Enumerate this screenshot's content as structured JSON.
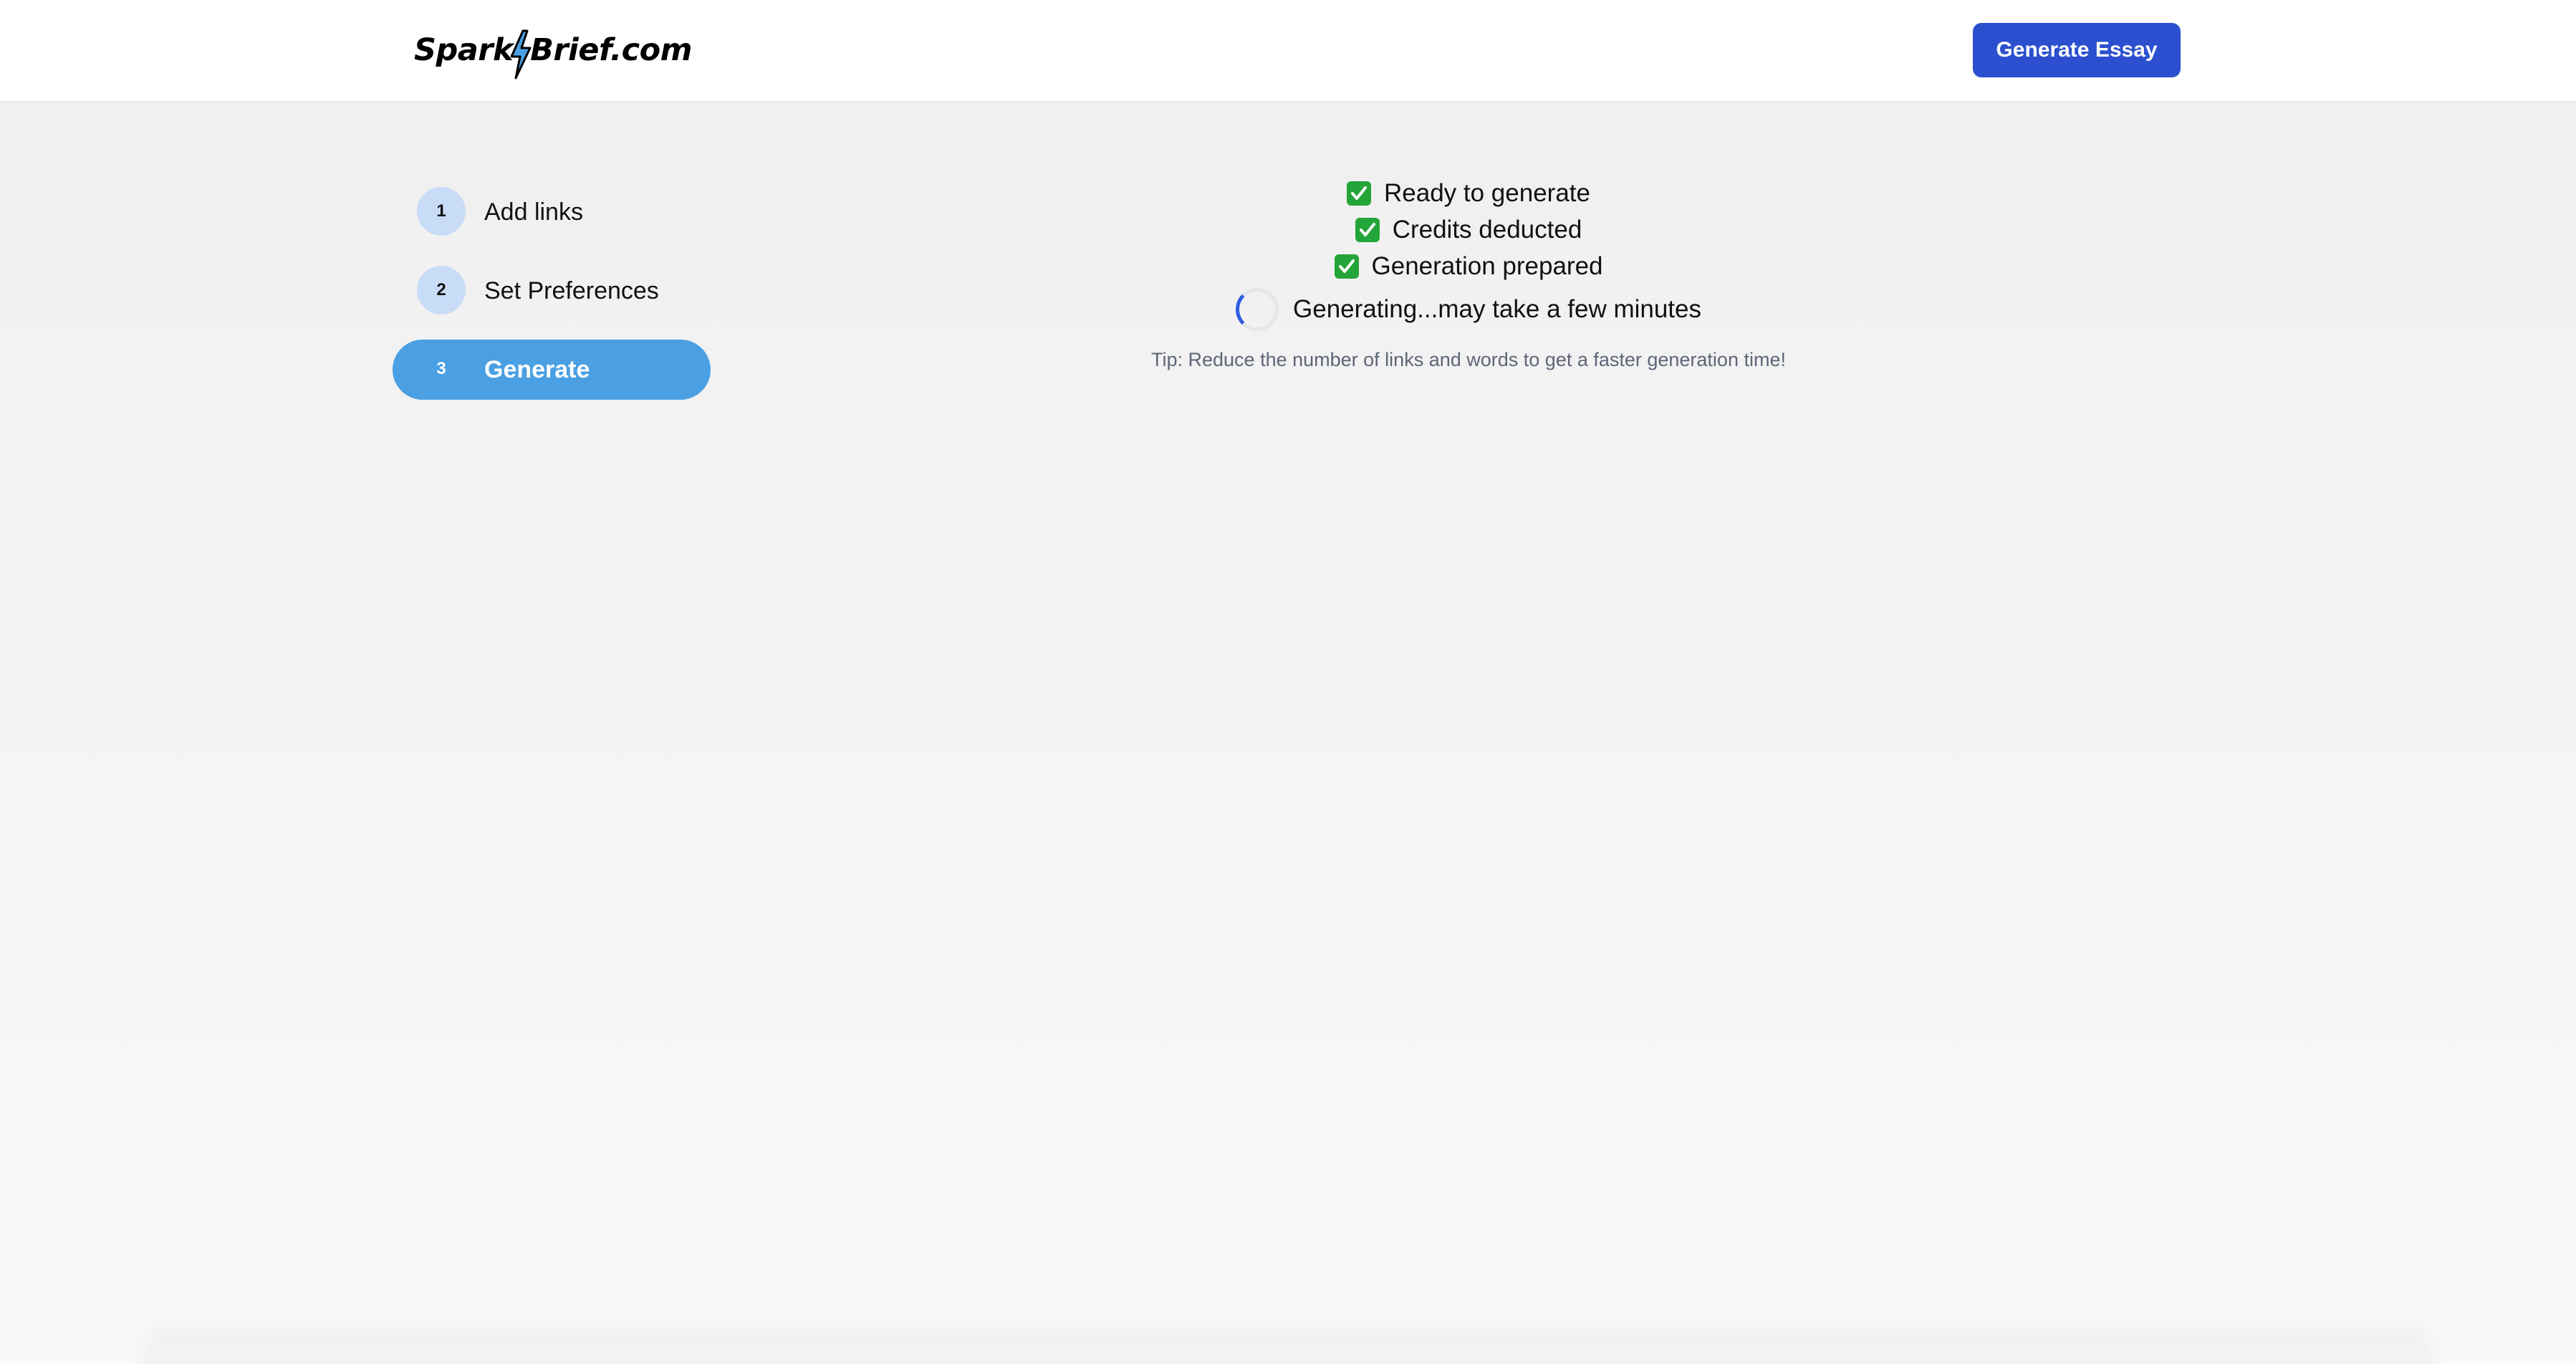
{
  "header": {
    "logo_left": "Spark",
    "logo_right": "Brief.com",
    "generate_button": "Generate Essay",
    "brand_color": "#2b4fce"
  },
  "steps": [
    {
      "number": "1",
      "label": "Add links",
      "active": false
    },
    {
      "number": "2",
      "label": "Set Preferences",
      "active": false
    },
    {
      "number": "3",
      "label": "Generate",
      "active": true
    }
  ],
  "status": {
    "lines": [
      {
        "text": "Ready to generate",
        "icon": "check-icon"
      },
      {
        "text": "Credits deducted",
        "icon": "check-icon"
      },
      {
        "text": "Generation prepared",
        "icon": "check-icon"
      }
    ],
    "loading_text": "Generating...may take a few minutes",
    "tip": "Tip: Reduce the number of links and words to get a faster generation time!"
  },
  "colors": {
    "active_step": "#4aa0e3",
    "step_circle": "#c8dbf7",
    "check": "#24a53a"
  }
}
